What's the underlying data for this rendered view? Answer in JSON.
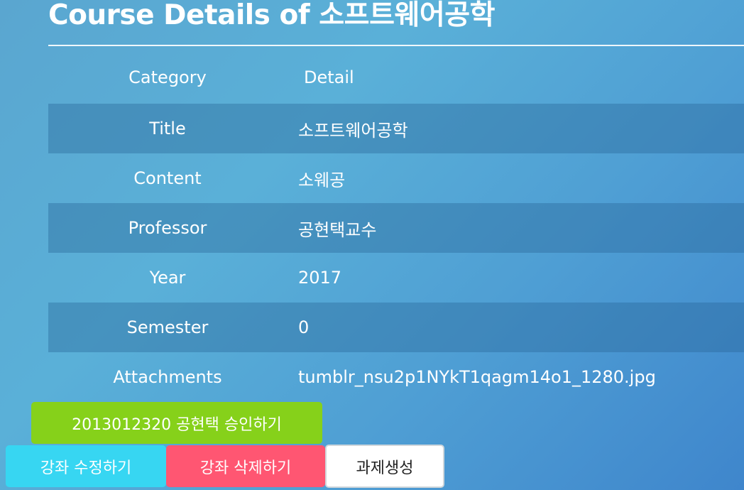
{
  "page": {
    "title": "Course Details of 소프트웨어공학"
  },
  "table": {
    "header": {
      "category": "Category",
      "detail": "Detail"
    },
    "rows": [
      {
        "category": "Title",
        "value": "소프트웨어공학"
      },
      {
        "category": "Content",
        "value": "소웨공"
      },
      {
        "category": "Professor",
        "value": "공현택교수"
      },
      {
        "category": "Year",
        "value": "2017"
      },
      {
        "category": "Semester",
        "value": "0"
      },
      {
        "category": "Attachments",
        "value": "tumblr_nsu2p1NYkT1qagm14o1_1280.jpg"
      }
    ]
  },
  "buttons": {
    "approve": "2013012320 공현택 승인하기",
    "edit": "강좌 수정하기",
    "delete": "강좌 삭제하기",
    "create_assignment": "과제생성"
  },
  "colors": {
    "approve": "#86d11a",
    "edit": "#37d6f2",
    "delete": "#ff5672",
    "create_assignment": "#ffffff"
  }
}
